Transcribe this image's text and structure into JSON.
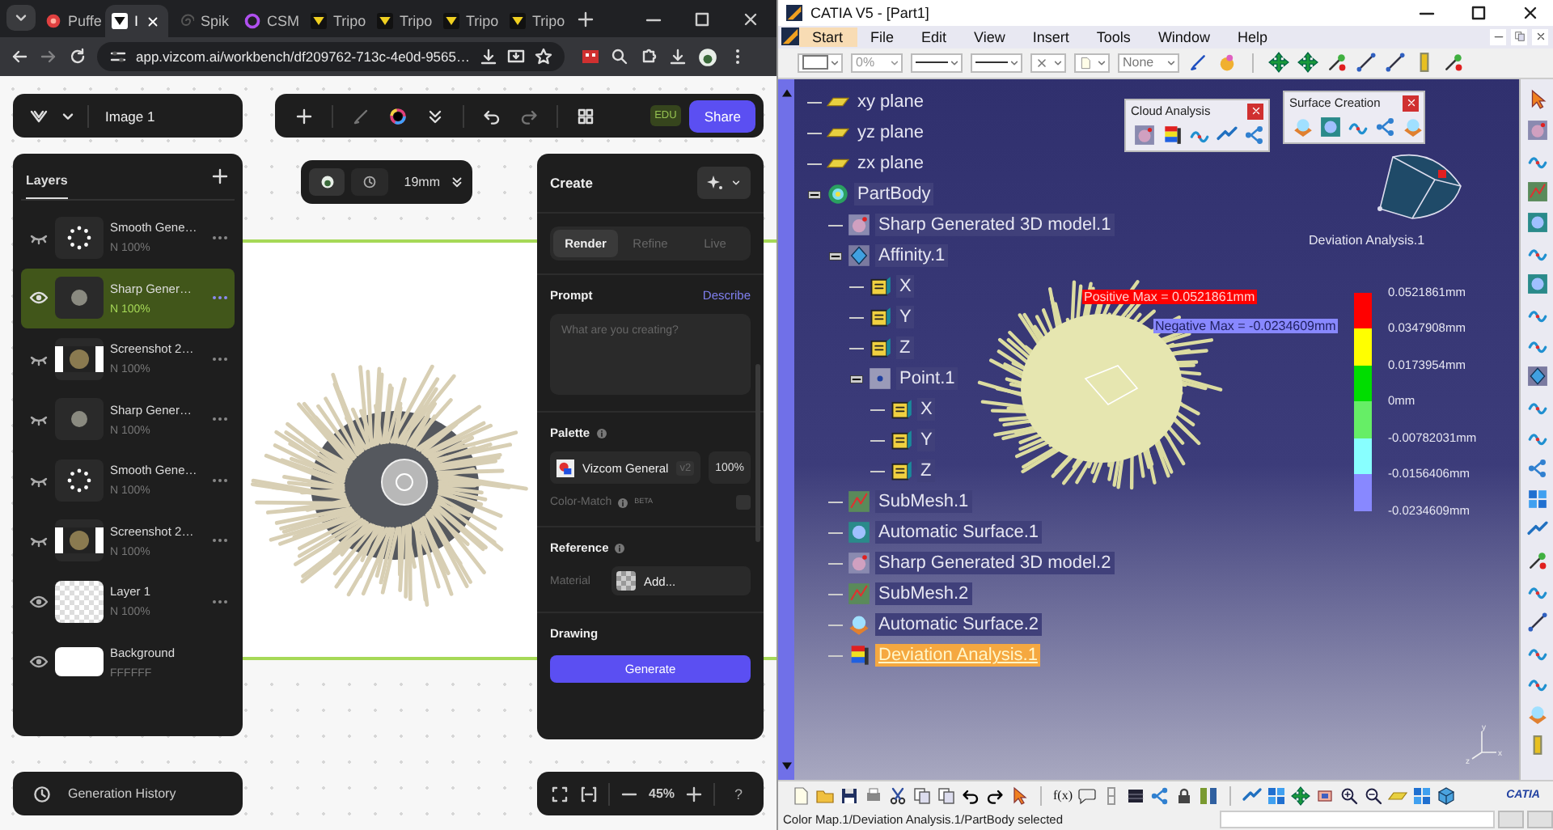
{
  "browser": {
    "tabs": [
      {
        "label": "Puffe",
        "selected": false
      },
      {
        "label": "I",
        "selected": true
      },
      {
        "label": "Spik",
        "selected": false
      },
      {
        "label": "CSM",
        "selected": false
      },
      {
        "label": "Tripo",
        "selected": false
      },
      {
        "label": "Tripo",
        "selected": false
      },
      {
        "label": "Tripo",
        "selected": false
      },
      {
        "label": "Tripo",
        "selected": false
      }
    ],
    "url": "app.vizcom.ai/workbench/df209762-713c-4e0d-9565…"
  },
  "vizcom": {
    "file_name": "Image 1",
    "plan_badge": "EDU",
    "share": "Share",
    "layers": {
      "title": "Layers",
      "items": [
        {
          "name": "Smooth Gene…",
          "blend": "N 100%",
          "kind": "dots",
          "visible": false,
          "selected": false
        },
        {
          "name": "Sharp Gener…",
          "blend": "N 100%",
          "kind": "model",
          "visible": true,
          "selected": true
        },
        {
          "name": "Screenshot 2…",
          "blend": "N 100%",
          "kind": "screenshot",
          "visible": false,
          "selected": false
        },
        {
          "name": "Sharp Gener…",
          "blend": "N 100%",
          "kind": "model",
          "visible": false,
          "selected": false
        },
        {
          "name": "Smooth Gene…",
          "blend": "N 100%",
          "kind": "dots",
          "visible": false,
          "selected": false
        },
        {
          "name": "Screenshot 2…",
          "blend": "N 100%",
          "kind": "screenshot",
          "visible": false,
          "selected": false
        },
        {
          "name": "Layer 1",
          "blend": "N 100%",
          "kind": "transparent",
          "visible": true,
          "selected": false
        },
        {
          "name": "Background",
          "sub": "FFFFFF",
          "kind": "color",
          "visible": true,
          "selected": false
        }
      ]
    },
    "size": "19mm",
    "create": {
      "title": "Create",
      "modes": [
        {
          "label": "Render",
          "selected": true
        },
        {
          "label": "Refine",
          "selected": false
        },
        {
          "label": "Live",
          "selected": false
        }
      ],
      "prompt": {
        "label": "Prompt",
        "action": "Describe",
        "placeholder": "What are you creating?"
      },
      "palette": {
        "label": "Palette",
        "name": "Vizcom General",
        "version": "v2",
        "strength": "100%",
        "color_match": {
          "label": "Color-Match",
          "badge": "BETA",
          "checked": false
        }
      },
      "reference": {
        "label": "Reference",
        "material_label": "Material",
        "add": "Add..."
      },
      "drawing": "Drawing",
      "generate": "Generate"
    },
    "zoom": "45%",
    "help": "?",
    "history": "Generation History"
  },
  "catia": {
    "title": "CATIA V5 - [Part1]",
    "menu": [
      {
        "label": "Start",
        "selected": true
      },
      {
        "label": "File",
        "selected": false
      },
      {
        "label": "Edit",
        "selected": false
      },
      {
        "label": "View",
        "selected": false
      },
      {
        "label": "Insert",
        "selected": false
      },
      {
        "label": "Tools",
        "selected": false
      },
      {
        "label": "Window",
        "selected": false
      },
      {
        "label": "Help",
        "selected": false
      }
    ],
    "toolbar": {
      "transparency": "0%",
      "layer": "None"
    },
    "cloud_analysis": "Cloud Analysis",
    "surface_creation": "Surface Creation",
    "tree": [
      {
        "label": "xy plane",
        "kind": "plane",
        "selected": false
      },
      {
        "label": "yz plane",
        "kind": "plane",
        "selected": false
      },
      {
        "label": "zx plane",
        "kind": "plane",
        "selected": false
      },
      {
        "label": "PartBody",
        "kind": "body",
        "selected": false,
        "expanded": true,
        "children": [
          {
            "label": "Sharp Generated 3D model.1",
            "kind": "mesh",
            "selected": false
          },
          {
            "label": "Affinity.1",
            "kind": "affinity",
            "selected": false,
            "expanded": true,
            "children": [
              {
                "label": "X",
                "kind": "param",
                "selected": false
              },
              {
                "label": "Y",
                "kind": "param",
                "selected": false
              },
              {
                "label": "Z",
                "kind": "param",
                "selected": false
              },
              {
                "label": "Point.1",
                "kind": "point",
                "selected": false,
                "expanded": true,
                "children": [
                  {
                    "label": "X",
                    "kind": "param",
                    "selected": false
                  },
                  {
                    "label": "Y",
                    "kind": "param",
                    "selected": false
                  },
                  {
                    "label": "Z",
                    "kind": "param",
                    "selected": false
                  }
                ]
              }
            ]
          },
          {
            "label": "SubMesh.1",
            "kind": "submesh",
            "selected": false
          },
          {
            "label": "Automatic Surface.1",
            "kind": "surface",
            "selected": false
          },
          {
            "label": "Sharp Generated 3D model.2",
            "kind": "mesh",
            "selected": false
          },
          {
            "label": "SubMesh.2",
            "kind": "submesh",
            "selected": false
          },
          {
            "label": "Automatic Surface.2",
            "kind": "surface2",
            "selected": false
          },
          {
            "label": "Deviation Analysis.1",
            "kind": "analysis",
            "selected": true
          }
        ]
      }
    ],
    "analysis_label": "Deviation Analysis.1",
    "positive_max": "Positive Max = 0.0521861mm",
    "negative_max": "Negative Max = -0.0234609mm",
    "legend": {
      "bands": [
        {
          "color": "#ff0000"
        },
        {
          "color": "#ffff00"
        },
        {
          "color": "#00dd00"
        },
        {
          "color": "#66ee66"
        },
        {
          "color": "#88ffff"
        },
        {
          "color": "#8888ff"
        }
      ],
      "values": [
        "0.0521861mm",
        "0.0347908mm",
        "0.0173954mm",
        "0mm",
        "-0.00782031mm",
        "-0.0156406mm",
        "-0.0234609mm"
      ]
    },
    "triad_labels": [
      "y",
      "x",
      "z"
    ],
    "formula": "f(x)",
    "logo": "CATIA",
    "status": "Color Map.1/Deviation Analysis.1/PartBody selected"
  }
}
